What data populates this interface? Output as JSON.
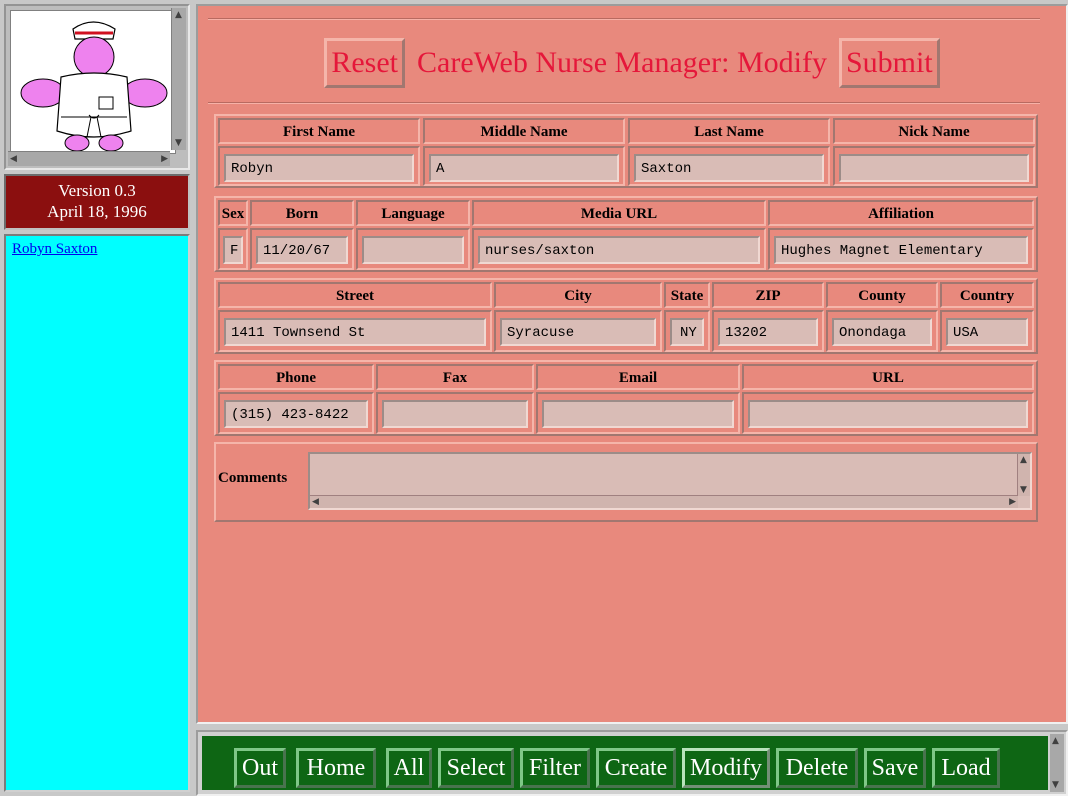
{
  "sidebar": {
    "version": "Version 0.3",
    "date": "April 18, 1996",
    "nurse_link": "Robyn Saxton"
  },
  "header": {
    "reset_label": "Reset",
    "title": "CareWeb Nurse Manager: Modify",
    "submit_label": "Submit"
  },
  "labels": {
    "first_name": "First Name",
    "middle_name": "Middle Name",
    "last_name": "Last Name",
    "nick_name": "Nick Name",
    "sex": "Sex",
    "born": "Born",
    "language": "Language",
    "media_url": "Media URL",
    "affiliation": "Affiliation",
    "street": "Street",
    "city": "City",
    "state": "State",
    "zip": "ZIP",
    "county": "County",
    "country": "Country",
    "phone": "Phone",
    "fax": "Fax",
    "email": "Email",
    "url": "URL",
    "comments": "Comments"
  },
  "values": {
    "first_name": "Robyn",
    "middle_name": "A",
    "last_name": "Saxton",
    "nick_name": "",
    "sex": "F",
    "born": "11/20/67",
    "language": "",
    "media_url": "nurses/saxton",
    "affiliation": "Hughes Magnet Elementary",
    "street": "1411 Townsend St",
    "city": "Syracuse",
    "state": "NY",
    "zip": "13202",
    "county": "Onondaga",
    "country": "USA",
    "phone": "(315) 423-8422",
    "fax": "",
    "email": "",
    "url": "",
    "comments": ""
  },
  "toolbar": {
    "buttons": [
      "Out",
      "Home",
      "All",
      "Select",
      "Filter",
      "Create",
      "Modify",
      "Delete",
      "Save",
      "Load"
    ],
    "active": "Modify"
  },
  "colors": {
    "main_bg": "#e8897d",
    "title_red": "#e5173a",
    "sidebar_list_bg": "#00ffff",
    "version_bg": "#8b0f0f",
    "toolbar_bg": "#0e6614"
  }
}
